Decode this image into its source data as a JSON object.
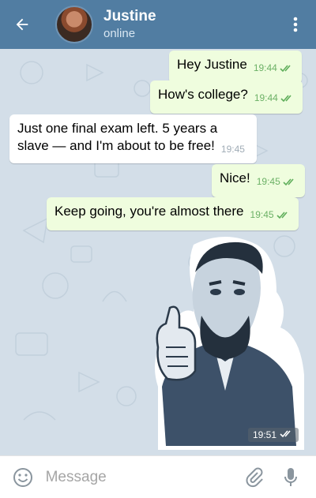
{
  "header": {
    "contact_name": "Justine",
    "status": "online",
    "back_icon": "arrow-left-icon",
    "menu_icon": "more-vertical-icon",
    "color": "#517da2"
  },
  "messages": [
    {
      "direction": "out",
      "text": "Hey Justine",
      "time": "19:44",
      "read": true
    },
    {
      "direction": "out",
      "text": "How's college?",
      "time": "19:44",
      "read": true
    },
    {
      "direction": "in",
      "text": "Just one final exam left. 5 years a slave — and I'm about to be free!",
      "time": "19:45"
    },
    {
      "direction": "out",
      "text": "Nice!",
      "time": "19:45",
      "read": true
    },
    {
      "direction": "out",
      "text": "Keep going, you're almost there",
      "time": "19:45",
      "read": true
    }
  ],
  "sticker": {
    "time": "19:51",
    "read": true,
    "icon": "lincoln-thumbs-up-sticker"
  },
  "composer": {
    "placeholder": "Message",
    "emoji_icon": "smile-icon",
    "attach_icon": "paperclip-icon",
    "mic_icon": "microphone-icon"
  },
  "colors": {
    "outgoing_bubble": "#effdde",
    "incoming_bubble": "#ffffff",
    "check_color": "#5fae5b"
  }
}
